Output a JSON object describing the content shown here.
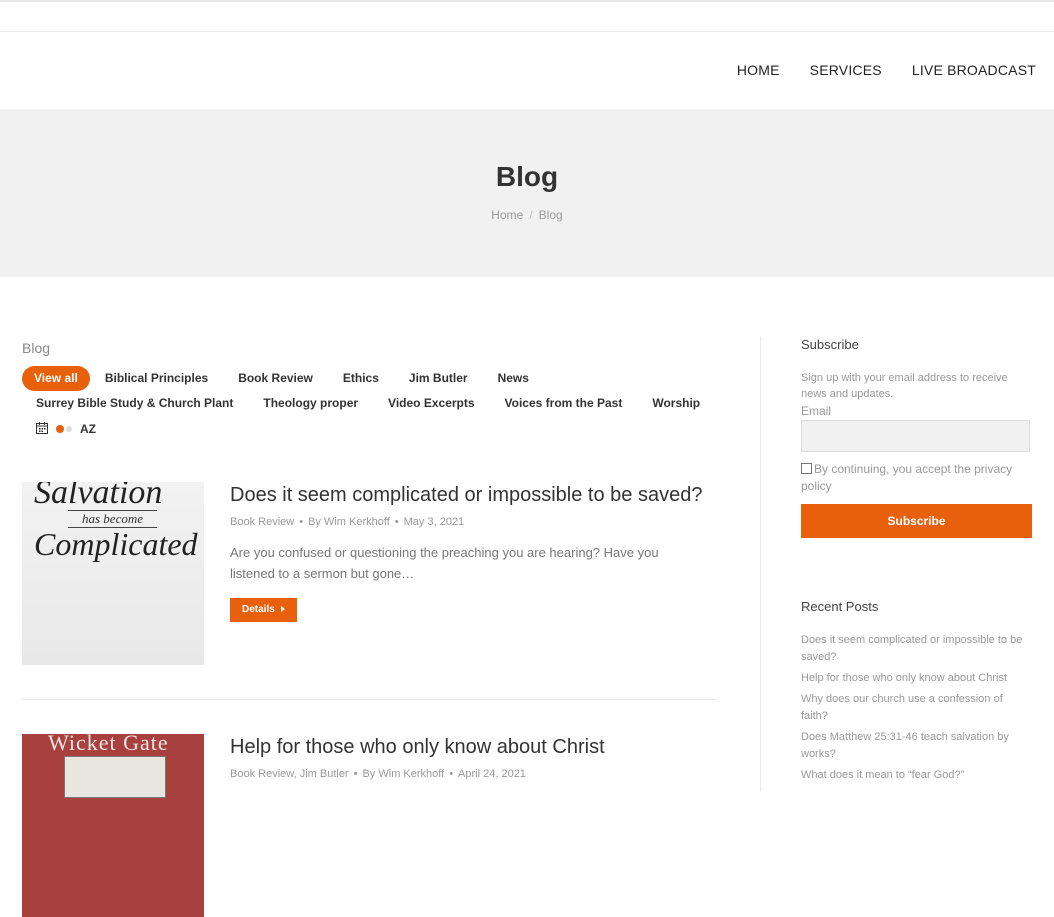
{
  "nav": {
    "items": [
      "HOME",
      "SERVICES",
      "LIVE BROADCAST"
    ]
  },
  "page": {
    "title": "Blog",
    "breadcrumb": {
      "home": "Home",
      "current": "Blog"
    }
  },
  "blog": {
    "label": "Blog",
    "filters_row1": [
      "View all",
      "Biblical Principles",
      "Book Review",
      "Ethics",
      "Jim Butler",
      "News"
    ],
    "filters_row2": [
      "Surrey Bible Study & Church Plant",
      "Theology proper",
      "Video Excerpts",
      "Voices from the Past",
      "Worship"
    ],
    "sort_label": "AZ",
    "accent_color": "#e8600c",
    "posts": [
      {
        "title": "Does it seem complicated or impossible to be saved?",
        "categories": "Book Review",
        "author": "By Wim Kerkhoff",
        "date": "May 3, 2021",
        "excerpt": "Are you confused or questioning the preaching you are hearing? Have you listened to a sermon but gone…",
        "details_label": "Details",
        "thumb": {
          "line1": "Salvation",
          "line2": "has become",
          "line3": "Complicated"
        }
      },
      {
        "title": "Help for those who only know about Christ",
        "categories": "Book Review, Jim Butler",
        "author": "By Wim Kerkhoff",
        "date": "April 24, 2021",
        "thumb": {
          "line1": "Wicket Gate"
        }
      }
    ]
  },
  "sidebar": {
    "subscribe": {
      "title": "Subscribe",
      "description": "Sign up with your email address to receive news and updates.",
      "email_label": "Email",
      "consent": "By continuing, you accept the privacy policy",
      "button": "Subscribe"
    },
    "recent": {
      "title": "Recent Posts",
      "items": [
        "Does it seem complicated or impossible to be saved?",
        "Help for those who only know about Christ",
        "Why does our church use a confession of faith?",
        "Does Matthew 25:31-46 teach salvation by works?",
        "What does it mean to “fear God?”"
      ]
    }
  }
}
